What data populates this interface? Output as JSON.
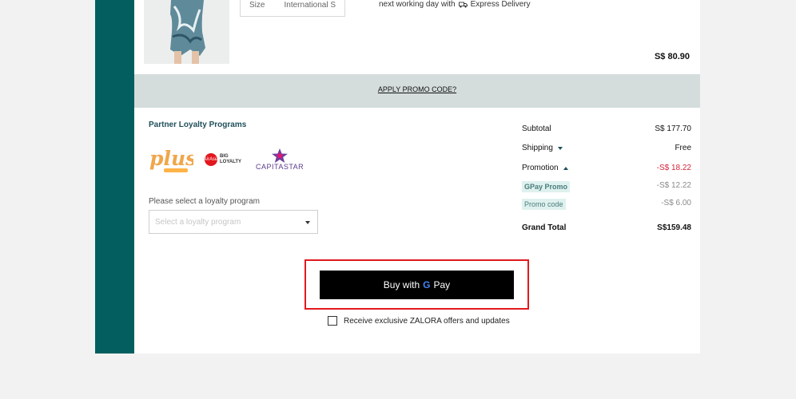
{
  "product": {
    "size_label": "Size",
    "size_value": "International S",
    "delivery_text": "next working day with",
    "delivery_service": "Express Delivery",
    "price": "S$ 80.90"
  },
  "promo": {
    "link_label": "APPLY PROMO CODE?"
  },
  "loyalty": {
    "title": "Partner Loyalty Programs",
    "logos": {
      "plus": "plus!",
      "big_badge": "AirAsia",
      "big_line1": "BIG",
      "big_line2": "LOYALTY",
      "capitastar": "CAPITASTAR"
    },
    "select_label": "Please select a loyalty program",
    "select_placeholder": "Select a loyalty program"
  },
  "summary": {
    "subtotal_label": "Subtotal",
    "subtotal_value": "S$ 177.70",
    "shipping_label": "Shipping",
    "shipping_value": "Free",
    "promotion_label": "Promotion",
    "promotion_value": "-S$ 18.22",
    "gpay_promo_label": "GPay Promo",
    "gpay_promo_value": "-S$ 12.22",
    "promo_code_label": "Promo code",
    "promo_code_value": "-S$ 6.00",
    "grand_total_label": "Grand Total",
    "grand_total_value": "S$159.48"
  },
  "checkout": {
    "button_prefix": "Buy with",
    "button_brand": "Pay",
    "optin_label": "Receive exclusive ZALORA offers and updates"
  },
  "colors": {
    "teal": "#035f5f",
    "promo_band": "#d4dcdc",
    "discount_red": "#d6263a",
    "highlight_red": "#e1191d"
  }
}
